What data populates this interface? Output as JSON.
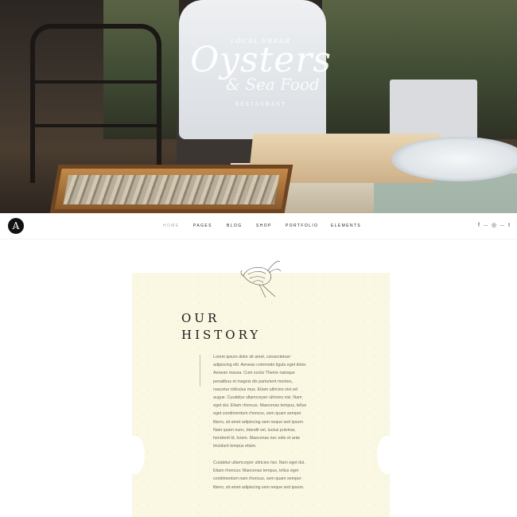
{
  "hero": {
    "kicker": "LOCAL FRESH",
    "title": "Oysters",
    "subtitle": "& Sea Food",
    "tag": "RESTAURANT"
  },
  "nav": {
    "logo": "A",
    "items": [
      {
        "label": "HOME",
        "active": true
      },
      {
        "label": "PAGES",
        "active": false
      },
      {
        "label": "BLOG",
        "active": false
      },
      {
        "label": "SHOP",
        "active": false
      },
      {
        "label": "PORTFOLIO",
        "active": false
      },
      {
        "label": "ELEMENTS",
        "active": false
      }
    ],
    "social": [
      {
        "icon": "facebook-icon",
        "glyph": "f"
      },
      {
        "icon": "instagram-icon",
        "glyph": "◎"
      },
      {
        "icon": "twitter-icon",
        "glyph": "t"
      }
    ]
  },
  "history": {
    "title_line1": "OUR",
    "title_line2": "HISTORY",
    "paragraph1": "Lorem ipsum dolor sit amet, consectetuer adipiscing elit. Aenean commodo ligula eget dolor. Aenean massa. Cum sociis Theme natoque penatibus et magnis dis parturient montes, nascetur ridiculus mus. Etiam ultricies nisi vel augue. Curabitur ullamcorper ultricies nisi. Nam eget dui. Etiam rhoncus. Maecenas tempus, tellus eget condimentum rhoncus, sem quam semper libero, sit amet adipiscing sem neque sed ipsum. Nam quam nunc, blandit vel, luctus pulvinar, hendrerit id, lorem. Maecenas nec odio et ante tincidunt tempus etiam.",
    "paragraph2": "Curabitur ullamcorper ultricies nisi. Nam eget dui. Etiam rhoncus. Maecenas tempus, tellus eget condimentum nam rhoncus, sem quam semper libero, sit amet adipiscing sem neque sed ipsum."
  }
}
